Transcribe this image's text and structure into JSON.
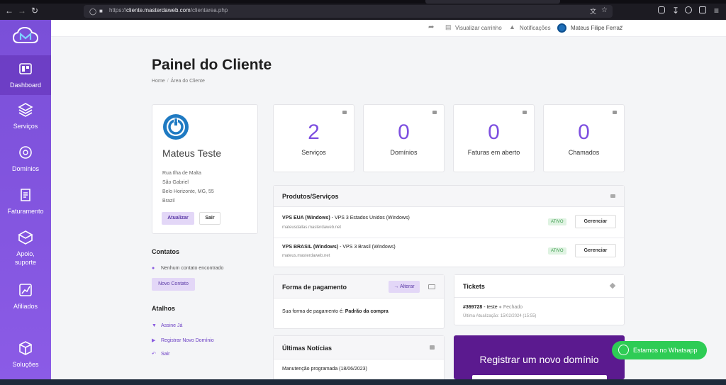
{
  "browser": {
    "url_prefix": "https://",
    "url_host": "cliente.masterdaweb.com",
    "url_path": "/clientarea.php"
  },
  "sidebar": {
    "items": [
      {
        "label": "Dashboard",
        "icon": "dashboard-icon"
      },
      {
        "label": "Serviços",
        "icon": "box-icon"
      },
      {
        "label": "Domínios",
        "icon": "globe-icon"
      },
      {
        "label": "Faturamento",
        "icon": "invoice-icon"
      },
      {
        "label": "Apoio, suporte",
        "icon": "support-icon"
      },
      {
        "label": "Afiliados",
        "icon": "affiliate-icon"
      },
      {
        "label": "Soluções",
        "icon": "solutions-icon"
      }
    ]
  },
  "topbar": {
    "cart": "Visualizar carrinho",
    "notifications": "Notificações",
    "user": "Mateus Filipe Ferraz"
  },
  "page": {
    "title": "Painel do Cliente",
    "breadcrumb": [
      "Home",
      "Área do Cliente"
    ]
  },
  "profile": {
    "name": "Mateus Teste",
    "address": [
      "Rua Ilha de Malta",
      "São Gabriel",
      "Belo Horizonte, MG, 55",
      "Brazil"
    ],
    "update_label": "Atualizar",
    "logout_label": "Sair"
  },
  "contacts": {
    "title": "Contatos",
    "empty": "Nenhum contato encontrado",
    "new_label": "Novo Contato"
  },
  "shortcuts": {
    "title": "Atalhos",
    "items": [
      "Assine Já",
      "Registrar Novo Domínio",
      "Sair"
    ]
  },
  "stats": [
    {
      "value": "2",
      "label": "Serviços"
    },
    {
      "value": "0",
      "label": "Domínios"
    },
    {
      "value": "0",
      "label": "Faturas em aberto"
    },
    {
      "value": "0",
      "label": "Chamados"
    }
  ],
  "products": {
    "title": "Produtos/Serviços",
    "items": [
      {
        "name": "VPS EUA (Windows)",
        "desc": " - VPS 3 Estados Unidos (Windows)",
        "domain": "mateusdallas.masterdaweb.net",
        "status": "ATIVO",
        "action": "Gerenciar"
      },
      {
        "name": "VPS BRASIL (Windows)",
        "desc": " - VPS 3 Brasil (Windows)",
        "domain": "mateus.masterdaweb.net",
        "status": "ATIVO",
        "action": "Gerenciar"
      }
    ]
  },
  "payment": {
    "title": "Forma de pagamento",
    "change_label": "Alterar",
    "text": "Sua forma de pagamento é: ",
    "method": "Padrão da compra"
  },
  "tickets": {
    "title": "Tickets",
    "ticket_id": "#369728",
    "ticket_subject": " - teste",
    "status": "Fechado",
    "updated": "Última Atualização: 15/02/2024 (15:55)"
  },
  "news": {
    "title": "Últimas Notícias",
    "item": "Manutenção programada (18/06/2023)"
  },
  "domain_register": {
    "title": "Registrar um novo domínio"
  },
  "whatsapp": {
    "label": "Estamos no Whatsapp"
  }
}
